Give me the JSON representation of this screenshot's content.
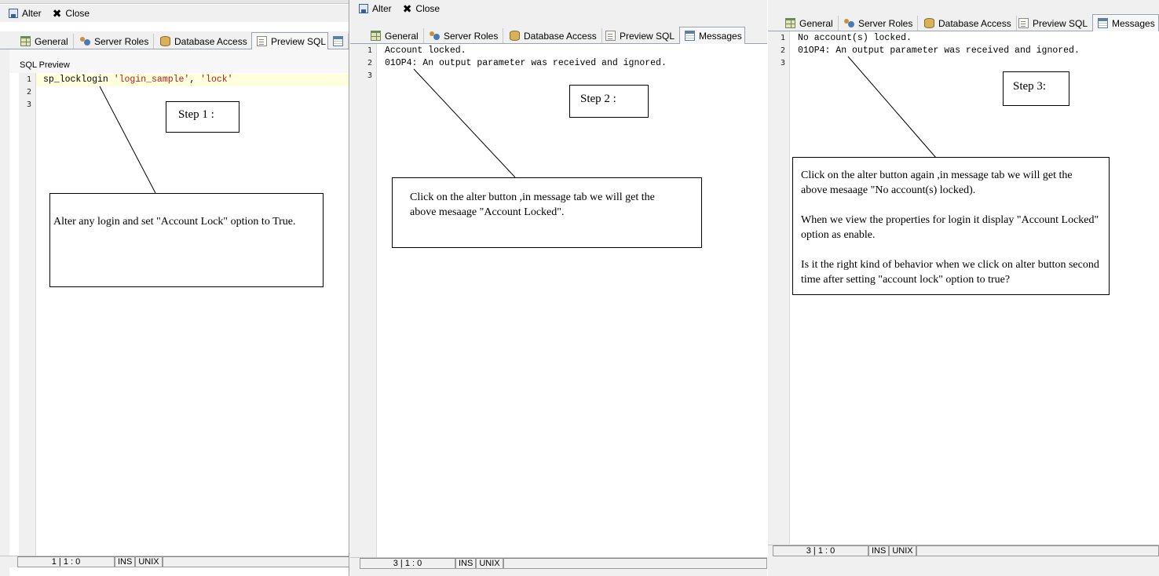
{
  "toolbar": {
    "alter_label": "Alter",
    "close_label": "Close"
  },
  "tabs": {
    "general": "General",
    "server_roles": "Server Roles",
    "database_access": "Database Access",
    "preview_sql": "Preview SQL",
    "messages": "Messages"
  },
  "panel1": {
    "section_label": "SQL Preview",
    "line_numbers": [
      "1",
      "2",
      "3"
    ],
    "code": {
      "fn": "sp_locklogin ",
      "arg1": "'login_sample'",
      "sep": ", ",
      "arg2": "'lock'"
    },
    "status": {
      "position": "1 | 1 : 0",
      "ins": "INS",
      "eol": "UNIX"
    },
    "step_label": "Step 1 :",
    "note_text": "Alter any login and set \"Account Lock\" option to True."
  },
  "panel2": {
    "line_numbers": [
      "1",
      "2",
      "3"
    ],
    "lines": [
      "Account locked.",
      "01OP4: An output parameter was received and ignored.",
      ""
    ],
    "status": {
      "position": "3 | 1 : 0",
      "ins": "INS",
      "eol": "UNIX"
    },
    "step_label": "Step 2 :",
    "note_text": "Click on the alter button ,in message  tab we will get the above mesaage \"Account Locked\"."
  },
  "panel3": {
    "line_numbers": [
      "1",
      "2",
      "3"
    ],
    "lines": [
      "No account(s) locked.",
      "01OP4: An output parameter was received and ignored.",
      ""
    ],
    "status": {
      "position": "3 | 1 : 0",
      "ins": "INS",
      "eol": "UNIX"
    },
    "step_label": "Step 3:",
    "note_paragraphs": [
      "Click on the alter button again ,in message  tab we will get the above mesaage \"No account(s) locked).",
      "When we view the properties for login it display \"Account Locked\" option as enable.",
      "Is it the right kind of behavior when we click on alter button second time after setting \"account lock\" option to true?"
    ]
  },
  "colors": {
    "string_literal": "#b21d1d",
    "chrome": "#f0f0f0",
    "current_line": "#ffffdd"
  }
}
